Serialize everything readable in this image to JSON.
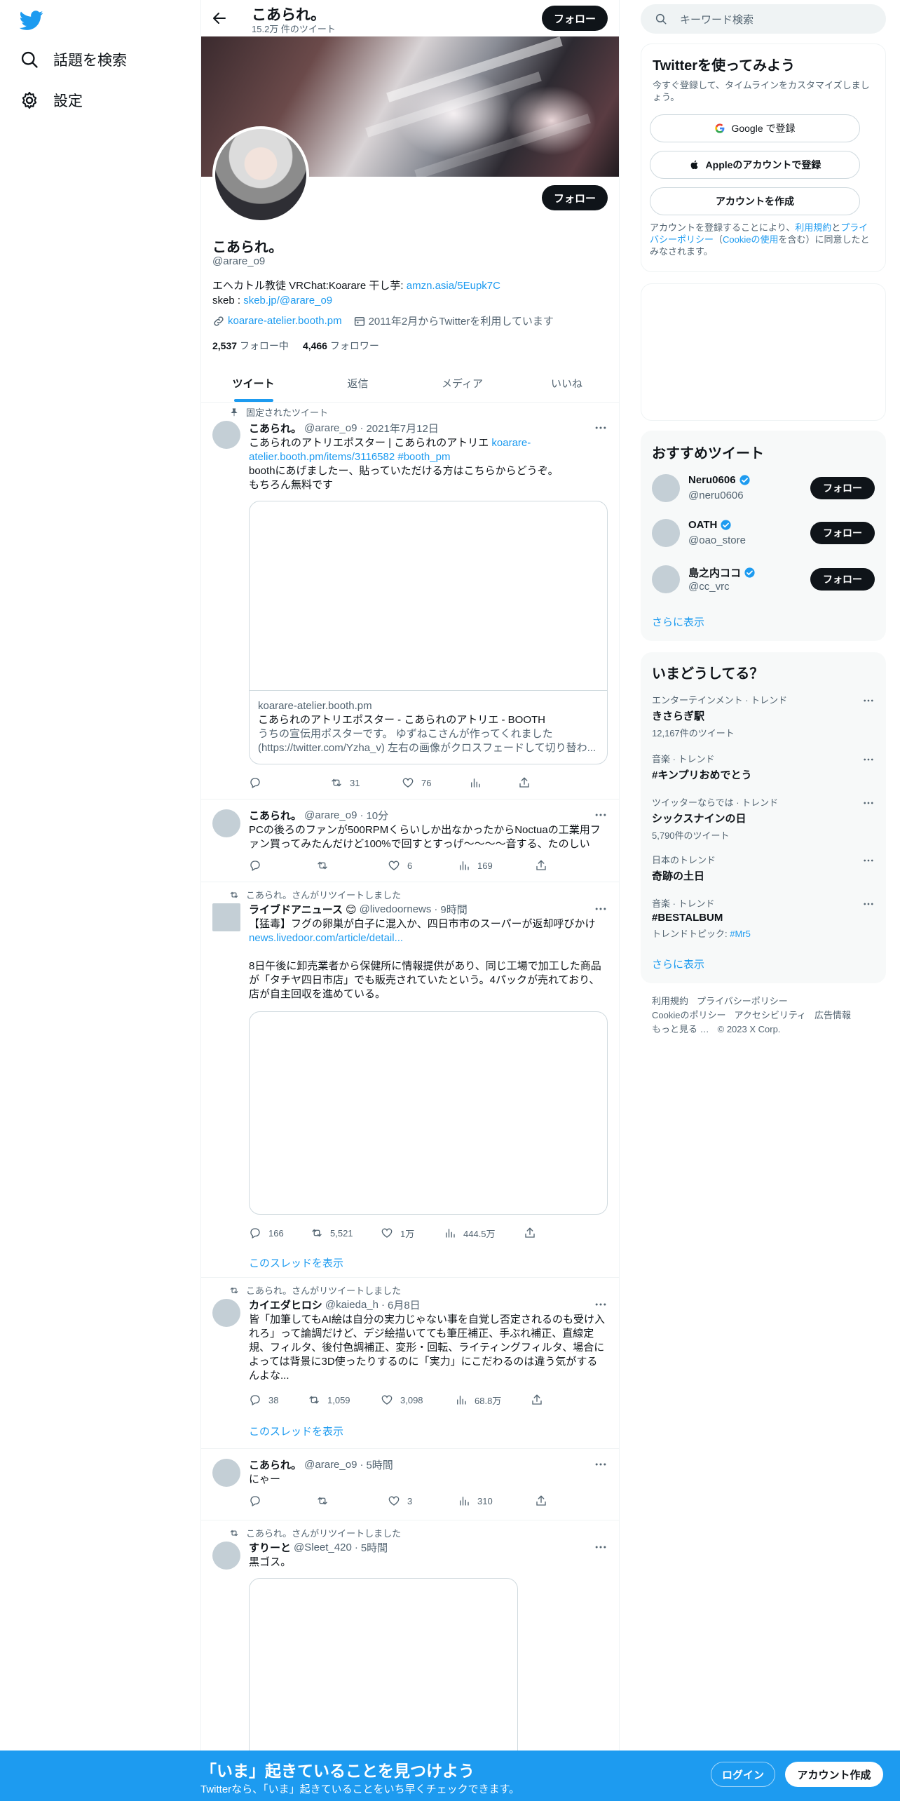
{
  "nav": {
    "explore": "話題を検索",
    "settings": "設定"
  },
  "header": {
    "title": "こあられ。",
    "subtitle": "15.2万 件のツイート",
    "follow": "フォロー"
  },
  "profile": {
    "name": "こあられ。",
    "handle": "@arare_o9",
    "bio_line1_text": "エヘカトル教徒 VRChat:Koarare 干し芋: ",
    "bio_line1_link": "amzn.asia/5Eupk7C",
    "bio_line2_text": "skeb : ",
    "bio_line2_link": "skeb.jp/@arare_o9",
    "website": "koarare-atelier.booth.pm",
    "joined": "2011年2月からTwitterを利用しています",
    "following_count": "2,537",
    "following_label": "フォロー中",
    "followers_count": "4,466",
    "followers_label": "フォロワー",
    "follow": "フォロー"
  },
  "tabs": [
    "ツイート",
    "返信",
    "メディア",
    "いいね"
  ],
  "tweets": [
    {
      "context": "固定されたツイート",
      "name": "こあられ。",
      "handle": "@arare_o9",
      "time": "2021年7月12日",
      "text_a": "こあられのアトリエポスター | こあられのアトリエ ",
      "link_a": "koarare-atelier.booth.pm/items/3116582",
      "hashtag": "#booth_pm",
      "text_b": "boothにあげましたー、貼っていただける方はこちらからどうぞ。",
      "text_c": "もちろん無料です",
      "card_domain": "koarare-atelier.booth.pm",
      "card_title": "こあられのアトリエポスター - こあられのアトリエ - BOOTH",
      "card_desc1": "うちの宣伝用ポスターです。 ゆずねこさんが作ってくれました",
      "card_desc2": "(https://twitter.com/Yzha_v) 左右の画像がクロスフェードして切り替わ...",
      "retweets": "31",
      "likes": "76"
    },
    {
      "name": "こあられ。",
      "handle": "@arare_o9",
      "time": "10分",
      "text_a": "PCの後ろのファンが500RPMくらいしか出なかったからNoctuaの工業用ファン買ってみたんだけど100%で回すとすっげ～～～～音する、たのしい",
      "likes": "6",
      "views": "169"
    },
    {
      "context": "こあられ。さんがリツイートしました",
      "name": "ライブドアニュース",
      "badge": "😊",
      "handle": "@livedoornews",
      "time": "9時間",
      "text_a": "【猛毒】フグの卵巣が白子に混入か、四日市市のスーパーが返却呼びかけ",
      "link_a": "news.livedoor.com/article/detail...",
      "text_b": "8日午後に卸売業者から保健所に情報提供があり、同じ工場で加工した商品が「タチヤ四日市店」でも販売されていたという。4パックが売れており、店が自主回収を進めている。",
      "replies": "166",
      "retweets": "5,521",
      "likes": "1万",
      "views": "444.5万",
      "thread": "このスレッドを表示"
    },
    {
      "context": "こあられ。さんがリツイートしました",
      "name": "カイエダヒロシ",
      "handle": "@kaieda_h",
      "time": "6月8日",
      "text_a": "皆「加筆してもAI絵は自分の実力じゃない事を自覚し否定されるのも受け入れろ」って論調だけど、デジ絵描いてても筆圧補正、手ぶれ補正、直線定規、フィルタ、後付色調補正、変形・回転、ライティングフィルタ、場合によっては背景に3D使ったりするのに「実力」にこだわるのは違う気がするんよな...",
      "replies": "38",
      "retweets": "1,059",
      "likes": "3,098",
      "views": "68.8万",
      "thread": "このスレッドを表示"
    },
    {
      "name": "こあられ。",
      "handle": "@arare_o9",
      "time": "5時間",
      "text_a": "にゃー",
      "likes": "3",
      "views": "310"
    },
    {
      "context": "こあられ。さんがリツイートしました",
      "name": "すりーと",
      "handle": "@Sleet_420",
      "time": "5時間",
      "text_a": "黒ゴス。"
    }
  ],
  "right": {
    "search_placeholder": "キーワード検索",
    "signup": {
      "title": "Twitterを使ってみよう",
      "subtitle": "今すぐ登録して、タイムラインをカスタマイズしましょう。",
      "google": "Google で登録",
      "apple": "Appleのアカウントで登録",
      "create": "アカウントを作成",
      "legal_a": "アカウントを登録することにより、",
      "legal_terms": "利用規約",
      "legal_b": "と",
      "legal_privacy": "プライバシーポリシー",
      "legal_c": "（",
      "legal_cookie": "Cookieの使用",
      "legal_d": "を含む）に同意したとみなされます。"
    },
    "recommend": {
      "title": "おすすめツイート",
      "users": [
        {
          "name": "Neru0606",
          "handle": "@neru0606"
        },
        {
          "name": "OATH",
          "handle": "@oao_store"
        },
        {
          "name": "島之内ココ",
          "handle": "@cc_vrc"
        }
      ],
      "follow": "フォロー",
      "more": "さらに表示"
    },
    "trends": {
      "title": "いまどうしてる？",
      "items": [
        {
          "category": "エンターテインメント · トレンド",
          "name": "きさらぎ駅",
          "count": "12,167件のツイート"
        },
        {
          "category": "音楽 · トレンド",
          "name": "#キンプリおめでとう",
          "count": ""
        },
        {
          "category": "ツイッターならでは · トレンド",
          "name": "シックスナインの日",
          "count": "5,790件のツイート"
        },
        {
          "category": "日本のトレンド",
          "name": "奇跡の土日",
          "count": ""
        },
        {
          "category": "音楽 · トレンド",
          "name": "#BESTALBUM",
          "count_prefix": "トレンドトピック: ",
          "count_link": "#Mr5"
        }
      ],
      "more": "さらに表示"
    },
    "footer": {
      "line1": [
        "利用規約",
        "プライバシーポリシー"
      ],
      "line2": [
        "Cookieのポリシー",
        "アクセシビリティ",
        "広告情報"
      ],
      "more": "もっと見る …",
      "copyright": "© 2023 X Corp."
    }
  },
  "bottom_bar": {
    "title": "「いま」起きていることを見つけよう",
    "subtitle": "Twitterなら、「いま」起きていることをいち早くチェックできます。",
    "login": "ログイン",
    "signup": "アカウント作成"
  },
  "colors": {
    "accent": "#1d9bf0",
    "text": "#0f1419",
    "muted": "#536471"
  }
}
